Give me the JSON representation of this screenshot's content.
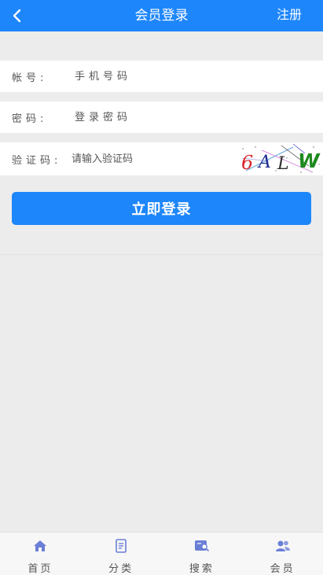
{
  "header": {
    "title": "会员登录",
    "register_label": "注册"
  },
  "form": {
    "account_label": "帐号:",
    "account_placeholder": "手机号码",
    "password_label": "密码:",
    "password_placeholder": "登录密码",
    "captcha_label": "验证码:",
    "captcha_placeholder": "请输入验证码",
    "captcha_text": [
      "6",
      "A",
      "L",
      "W"
    ]
  },
  "login_button": "立即登录",
  "bottom_nav": [
    {
      "label": "首页",
      "icon": "home-icon"
    },
    {
      "label": "分类",
      "icon": "category-icon"
    },
    {
      "label": "搜索",
      "icon": "search-icon"
    },
    {
      "label": "会员",
      "icon": "member-icon"
    }
  ],
  "colors": {
    "primary": "#1e86fb",
    "background": "#ececec",
    "nav_icon": "#6a7fd6"
  }
}
